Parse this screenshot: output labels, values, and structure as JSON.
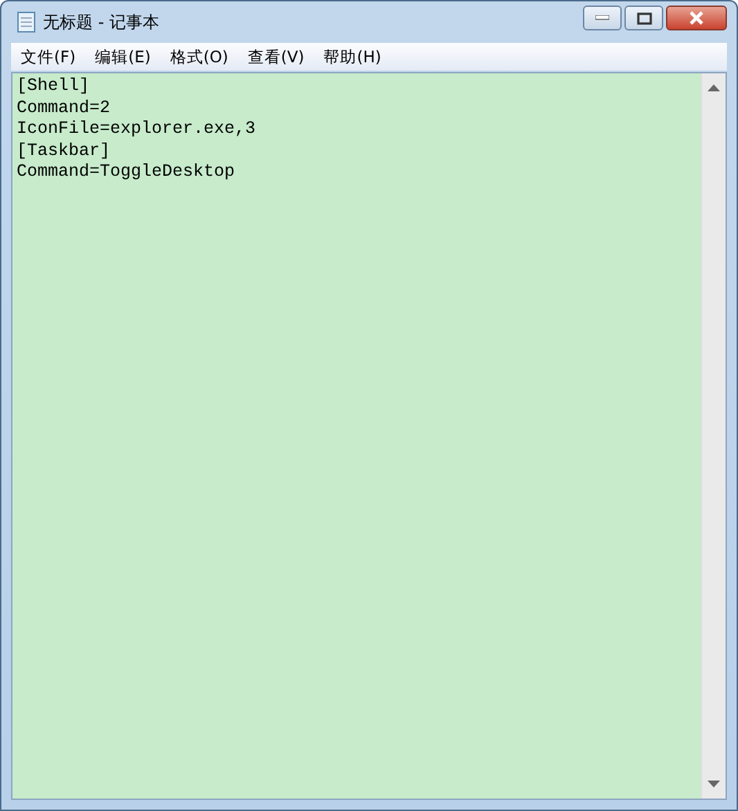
{
  "window": {
    "title": "无标题 - 记事本"
  },
  "menu": [
    "文件(F)",
    "编辑(E)",
    "格式(O)",
    "查看(V)",
    "帮助(H)"
  ],
  "editor": {
    "lines": [
      "[Shell]",
      "Command=2",
      "IconFile=explorer.exe,3",
      "[Taskbar]",
      "Command=ToggleDesktop"
    ]
  }
}
